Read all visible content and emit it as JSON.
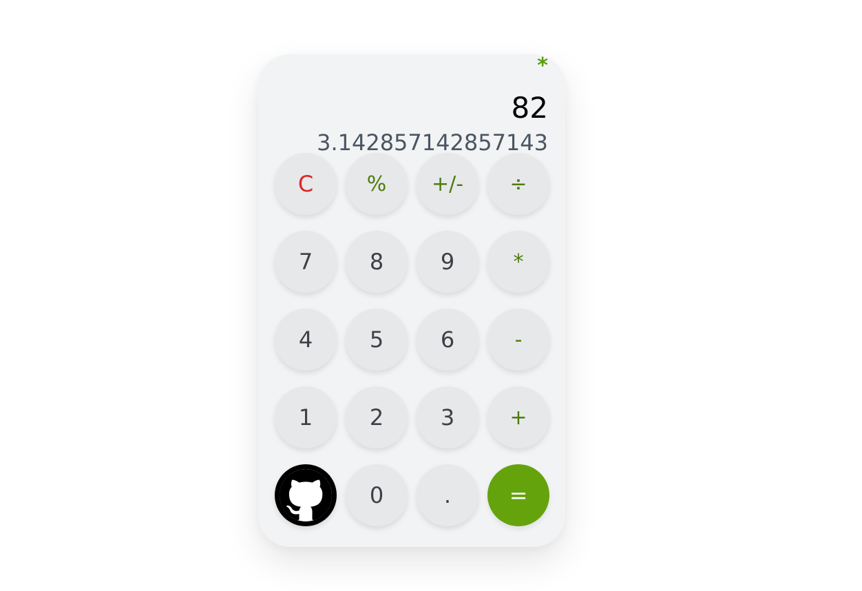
{
  "display": {
    "operator": "*",
    "current": "82",
    "previous": "3.142857142857143"
  },
  "keys": {
    "clear": "C",
    "percent": "%",
    "negate": "+/-",
    "divide": "÷",
    "seven": "7",
    "eight": "8",
    "nine": "9",
    "multiply": "*",
    "four": "4",
    "five": "5",
    "six": "6",
    "subtract": "-",
    "one": "1",
    "two": "2",
    "three": "3",
    "add": "+",
    "zero": "0",
    "decimal": ".",
    "equals": "="
  },
  "icons": {
    "github": "github-icon"
  },
  "colors": {
    "accent": "#65a30d",
    "operator_text": "#4d7c0f",
    "clear_text": "#dc2626",
    "key_bg": "#e7e8ea",
    "panel_bg": "#f2f3f4"
  }
}
